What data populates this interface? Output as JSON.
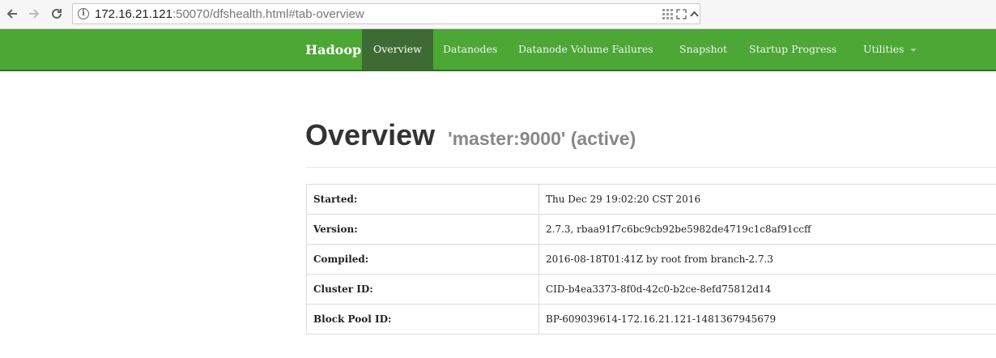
{
  "browser": {
    "url_host": "172.16.21.121",
    "url_rest": ":50070/dfshealth.html#tab-overview"
  },
  "navbar": {
    "brand": "Hadoop",
    "items": [
      {
        "label": "Overview",
        "active": true
      },
      {
        "label": "Datanodes"
      },
      {
        "label": "Datanode Volume Failures"
      },
      {
        "label": "Snapshot"
      },
      {
        "label": "Startup Progress"
      },
      {
        "label": "Utilities"
      }
    ]
  },
  "header": {
    "title": "Overview",
    "subtitle": "'master:9000' (active)"
  },
  "overview": {
    "rows": [
      {
        "key": "Started:",
        "value": "Thu Dec 29 19:02:20 CST 2016"
      },
      {
        "key": "Version:",
        "value": "2.7.3, rbaa91f7c6bc9cb92be5982de4719c1c8af91ccff"
      },
      {
        "key": "Compiled:",
        "value": "2016-08-18T01:41Z by root from branch-2.7.3"
      },
      {
        "key": "Cluster ID:",
        "value": "CID-b4ea3373-8f0d-42c0-b2ce-8efd75812d14"
      },
      {
        "key": "Block Pool ID:",
        "value": "BP-609039614-172.16.21.121-1481367945679"
      }
    ]
  }
}
